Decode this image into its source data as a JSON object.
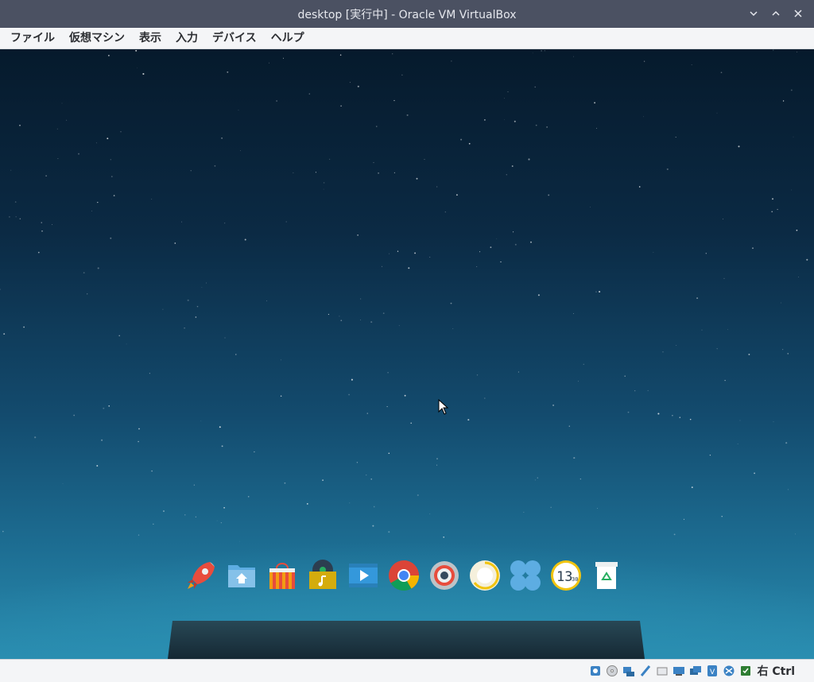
{
  "window": {
    "title": "desktop [実行中] - Oracle VM VirtualBox",
    "controls": [
      "minimize-icon",
      "maximize-icon",
      "close-icon"
    ]
  },
  "menubar": {
    "items": [
      {
        "label": "ファイル"
      },
      {
        "label": "仮想マシン"
      },
      {
        "label": "表示"
      },
      {
        "label": "入力"
      },
      {
        "label": "デバイス"
      },
      {
        "label": "ヘルプ"
      }
    ]
  },
  "dock": {
    "items": [
      {
        "name": "launcher-rocket-icon"
      },
      {
        "name": "file-manager-icon"
      },
      {
        "name": "app-store-icon"
      },
      {
        "name": "music-player-icon"
      },
      {
        "name": "video-player-icon"
      },
      {
        "name": "chrome-browser-icon"
      },
      {
        "name": "settings-icon"
      },
      {
        "name": "system-monitor-icon"
      },
      {
        "name": "multitask-view-icon"
      },
      {
        "name": "clock-icon"
      },
      {
        "name": "trash-icon"
      }
    ],
    "clock_text": "13",
    "clock_sub": "30"
  },
  "statusbar": {
    "icons": [
      "hard-disk-icon",
      "optical-drive-icon",
      "audio-icon",
      "network-icon",
      "usb-icon",
      "shared-folder-icon",
      "display-icon",
      "video-capture-icon",
      "recording-icon",
      "cpu-icon",
      "mouse-integration-icon"
    ],
    "host_key": "右 Ctrl"
  },
  "colors": {
    "titlebar": "#4b5162",
    "menubar": "#f4f5f7",
    "accent_blue": "#2a8db0"
  }
}
